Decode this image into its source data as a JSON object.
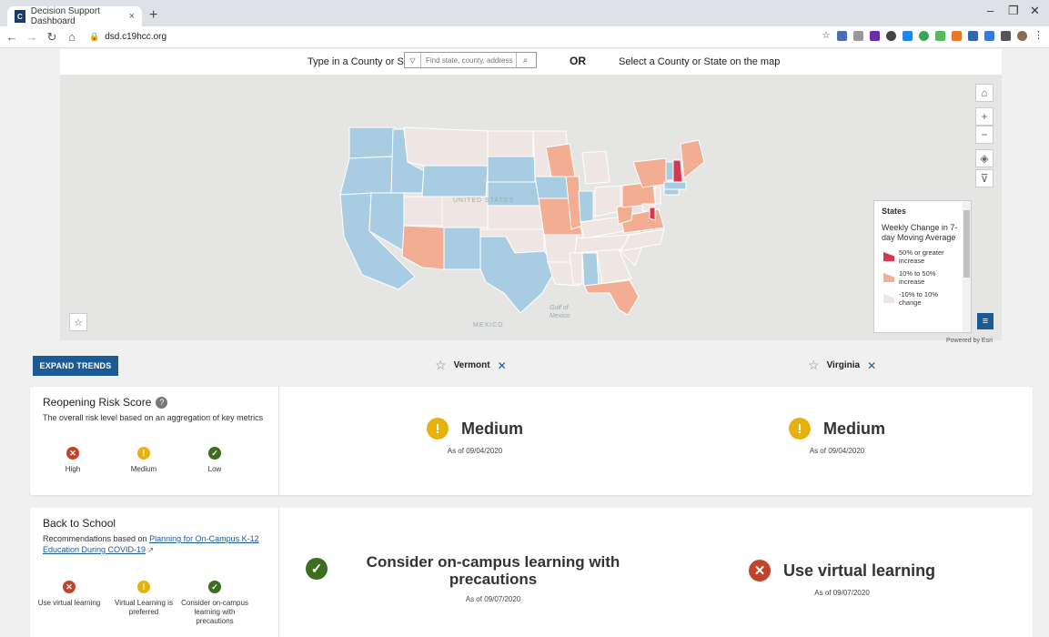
{
  "browser": {
    "tab_title": "Decision Support Dashboard",
    "tab_close": "×",
    "new_tab": "+",
    "url": "dsd.c19hcc.org",
    "window_controls": [
      "–",
      "❐",
      "✕"
    ],
    "favicon_letter": "C"
  },
  "search": {
    "label": "Type in a County or State",
    "placeholder": "Find state, county, address",
    "or": "OR",
    "select_label": "Select a County or State on the map"
  },
  "map": {
    "labels": [
      "UNITED STATES",
      "MEXICO",
      "Gulf of Mexico"
    ],
    "powered_by": "Powered by Esri",
    "state_colors": {
      "high": "#d6384d",
      "mid": "#f2ad93",
      "flat": "#efe6e3",
      "decrease": "#a8cde3"
    },
    "legend": {
      "title": "States",
      "subtitle": "Weekly Change in 7-day Moving Average",
      "items": [
        {
          "label": "50% or greater increase",
          "color": "#d6384d"
        },
        {
          "label": "10% to 50% increase",
          "color": "#f2ad93"
        },
        {
          "label": "-10% to 10% change",
          "color": "#efe6e3"
        }
      ]
    }
  },
  "trends": {
    "expand_label": "EXPAND TRENDS",
    "locations": [
      "Vermont",
      "Virginia"
    ]
  },
  "risk": {
    "title": "Reopening Risk Score",
    "help": "?",
    "subtitle": "The overall risk level based on an aggregation of key metrics",
    "scale": [
      {
        "label": "High",
        "level": "red",
        "glyph": "✕"
      },
      {
        "label": "Medium",
        "level": "yellow",
        "glyph": "!"
      },
      {
        "label": "Low",
        "level": "green",
        "glyph": "✓"
      }
    ],
    "vermont": {
      "value": "Medium",
      "as_of": "As of 09/04/2020",
      "glyph": "!"
    },
    "virginia": {
      "value": "Medium",
      "as_of": "As of 09/04/2020",
      "glyph": "!"
    }
  },
  "school": {
    "title": "Back to School",
    "subtitle_prefix": "Recommendations based on ",
    "link": "Planning for On-Campus K-12 Education During COVID-19",
    "scale": [
      {
        "label": "Use virtual learning",
        "level": "red",
        "glyph": "✕"
      },
      {
        "label": "Virtual Learning is preferred",
        "level": "yellow",
        "glyph": "!"
      },
      {
        "label": "Consider on-campus learning with precautions",
        "level": "green",
        "glyph": "✓"
      }
    ],
    "vermont": {
      "value": "Consider on-campus learning with precautions",
      "as_of": "As of 09/07/2020",
      "glyph": "✓"
    },
    "virginia": {
      "value": "Use virtual learning",
      "as_of": "As of 09/07/2020",
      "glyph": "✕"
    }
  }
}
